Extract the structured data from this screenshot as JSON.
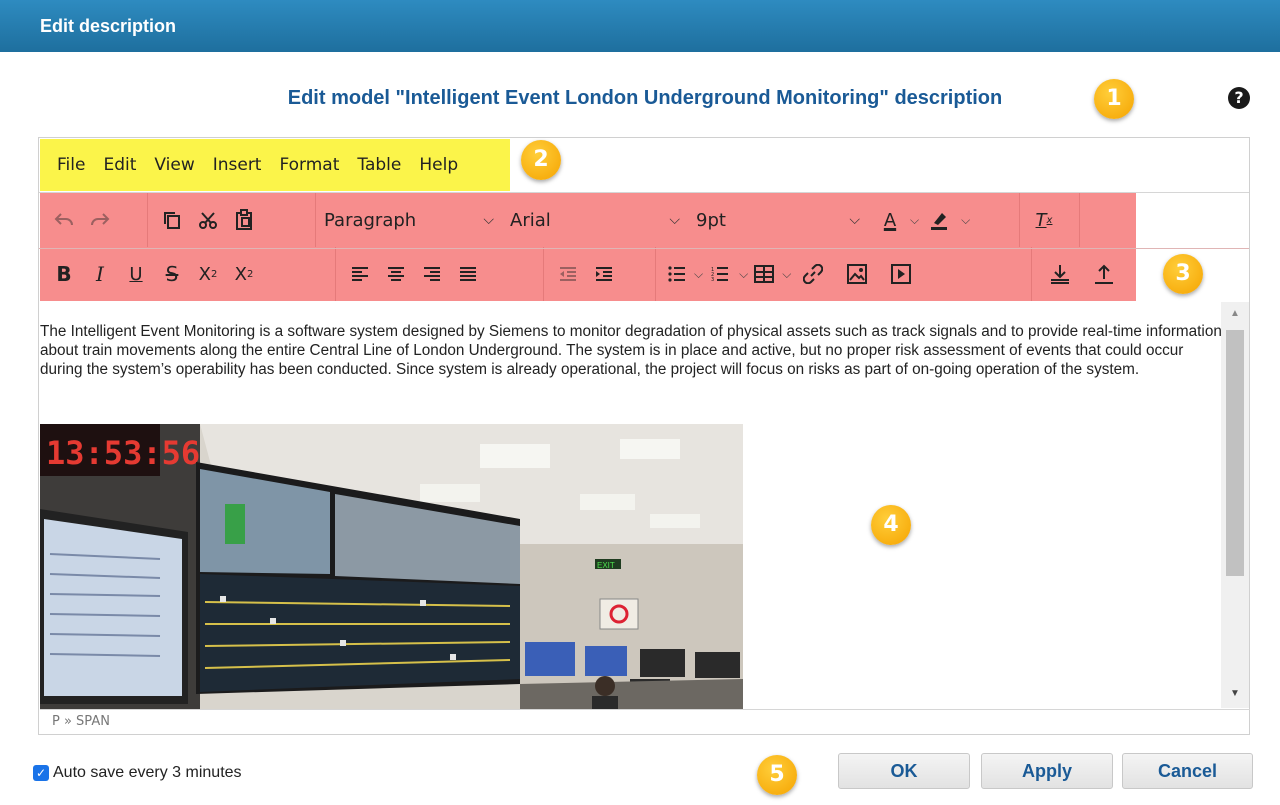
{
  "dialog": {
    "title": "Edit description"
  },
  "heading": "Edit model \"Intelligent Event London Underground Monitoring\" description",
  "help_label": "?",
  "badges": [
    "1",
    "2",
    "3",
    "4",
    "5"
  ],
  "menubar": {
    "items": [
      "File",
      "Edit",
      "View",
      "Insert",
      "Format",
      "Table",
      "Help"
    ]
  },
  "toolbar": {
    "block_format": "Paragraph",
    "font_family": "Arial",
    "font_size": "9pt"
  },
  "content": {
    "paragraph": "The Intelligent Event Monitoring is a software system designed by Siemens to monitor degradation of physical assets such as track signals and to provide real-time information about train movements along the entire Central Line of London Underground. The system is in place and active, but no proper risk assessment of events that could occur during the system’s operability has been conducted. Since system is already operational, the project will focus on risks as part of on-going operation of the system.",
    "photo_clock": "13:53:56",
    "photo_sign": "EXIT"
  },
  "statusbar": {
    "path": "P » SPAN"
  },
  "footer": {
    "autosave_label": "Auto save every 3 minutes",
    "autosave_checked": true,
    "ok_label": "OK",
    "apply_label": "Apply",
    "cancel_label": "Cancel"
  },
  "colors": {
    "header": "#2a82b6",
    "heading_text": "#1a5a96",
    "menubar_highlight": "#fbf44a",
    "toolbar_highlight": "#f78d8d",
    "badge": "#f5a300"
  }
}
